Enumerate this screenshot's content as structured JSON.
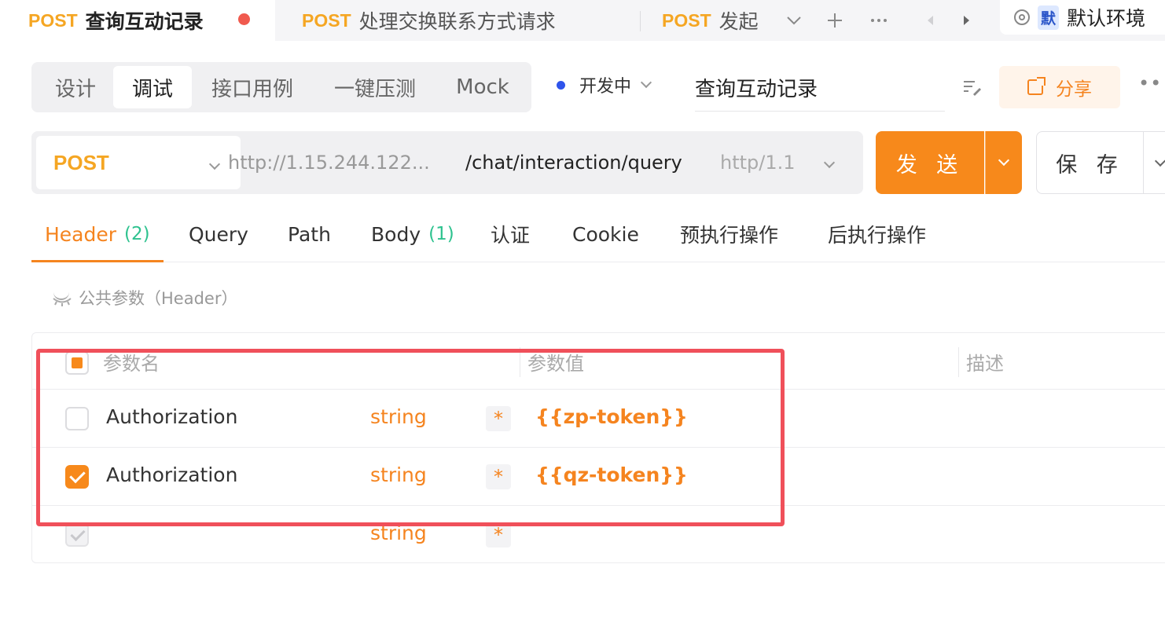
{
  "tabs": [
    {
      "method": "POST",
      "title": "查询互动记录",
      "unsaved": true,
      "active": true
    },
    {
      "method": "POST",
      "title": "处理交换联系方式请求",
      "active": false
    },
    {
      "method": "POST",
      "title": "发起",
      "active": false
    }
  ],
  "tab_controls": {
    "dropdown_icon": "chevron-down-icon",
    "add_icon": "plus-icon",
    "more_icon": "more-horizontal-icon"
  },
  "environment": {
    "badge": "默",
    "name": "默认环境"
  },
  "modes": [
    "设计",
    "调试",
    "接口用例",
    "一键压测",
    "Mock"
  ],
  "active_mode": "调试",
  "status": {
    "label": "开发中",
    "color": "#2f54eb"
  },
  "api_name": "查询互动记录",
  "share_label": "分享",
  "request": {
    "method": "POST",
    "base_url": "http://1.15.244.122...",
    "path": "/chat/interaction/query",
    "protocol": "http/1.1"
  },
  "send_label": "发 送",
  "save_label": "保 存",
  "request_tabs": [
    {
      "label": "Header",
      "count": "(2)"
    },
    {
      "label": "Query",
      "count": ""
    },
    {
      "label": "Path",
      "count": ""
    },
    {
      "label": "Body",
      "count": "(1)"
    },
    {
      "label": "认证",
      "count": ""
    },
    {
      "label": "Cookie",
      "count": ""
    },
    {
      "label": "预执行操作",
      "count": ""
    },
    {
      "label": "后执行操作",
      "count": ""
    }
  ],
  "public_params_label": "公共参数（Header）",
  "table": {
    "headers": {
      "name": "参数名",
      "value": "参数值",
      "desc": "描述"
    },
    "rows": [
      {
        "checked": false,
        "name": "Authorization",
        "type": "string",
        "required": "*",
        "value": "{{zp-token}}"
      },
      {
        "checked": true,
        "name": "Authorization",
        "type": "string",
        "required": "*",
        "value": "{{qz-token}}"
      },
      {
        "checked": true,
        "disabled": true,
        "name": "",
        "type": "string",
        "required": "*",
        "value": ""
      }
    ]
  },
  "colors": {
    "accent": "#f7891b",
    "method": "#f5a623",
    "count": "#2ec28f",
    "highlight": "#f0505a"
  }
}
